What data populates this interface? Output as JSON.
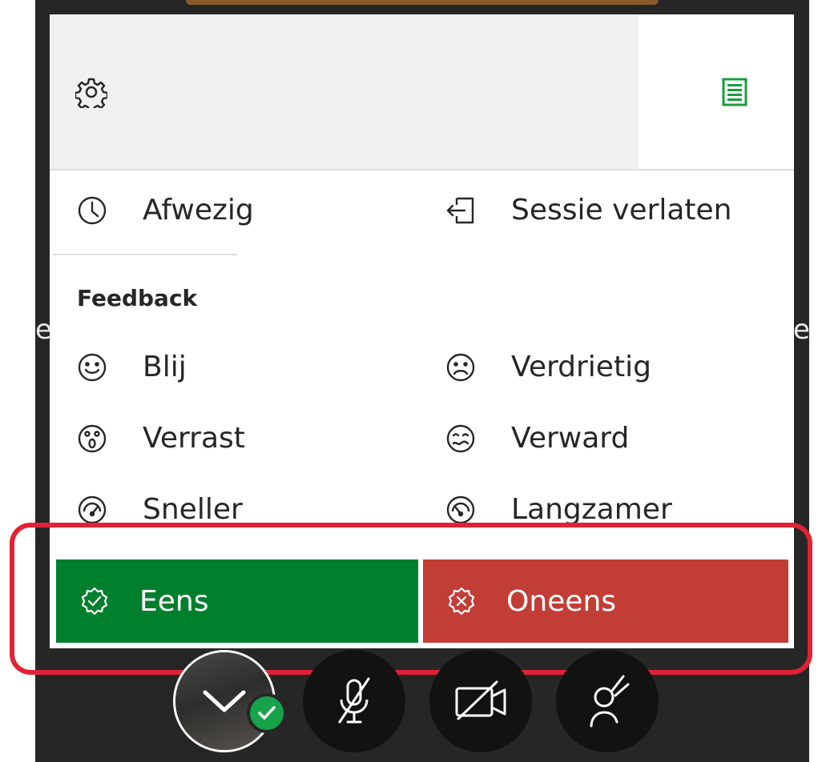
{
  "edge_text": {
    "left": "e",
    "right": "e"
  },
  "tabs": {
    "settings_icon": "gear-icon",
    "menu_icon": "menu-list-icon"
  },
  "menu": {
    "away": "Afwezig",
    "leave": "Sessie verlaten"
  },
  "feedback": {
    "heading": "Feedback",
    "items": [
      {
        "label": "Blij",
        "icon": "happy-face-icon"
      },
      {
        "label": "Verdrietig",
        "icon": "sad-face-icon"
      },
      {
        "label": "Verrast",
        "icon": "surprised-face-icon"
      },
      {
        "label": "Verward",
        "icon": "confused-face-icon"
      },
      {
        "label": "Sneller",
        "icon": "speed-up-icon"
      },
      {
        "label": "Langzamer",
        "icon": "slow-down-icon"
      }
    ],
    "agree": "Eens",
    "disagree": "Oneens"
  },
  "colors": {
    "agree": "#007f2d",
    "disagree": "#c33d37",
    "accent_green": "#1a9c3e",
    "highlight": "#e02235"
  },
  "controls": [
    {
      "name": "collapse-menu-button",
      "icon": "chevron-down-icon"
    },
    {
      "name": "microphone-button",
      "icon": "microphone-off-icon"
    },
    {
      "name": "camera-button",
      "icon": "camera-off-icon"
    },
    {
      "name": "raise-hand-button",
      "icon": "raise-hand-icon"
    }
  ]
}
